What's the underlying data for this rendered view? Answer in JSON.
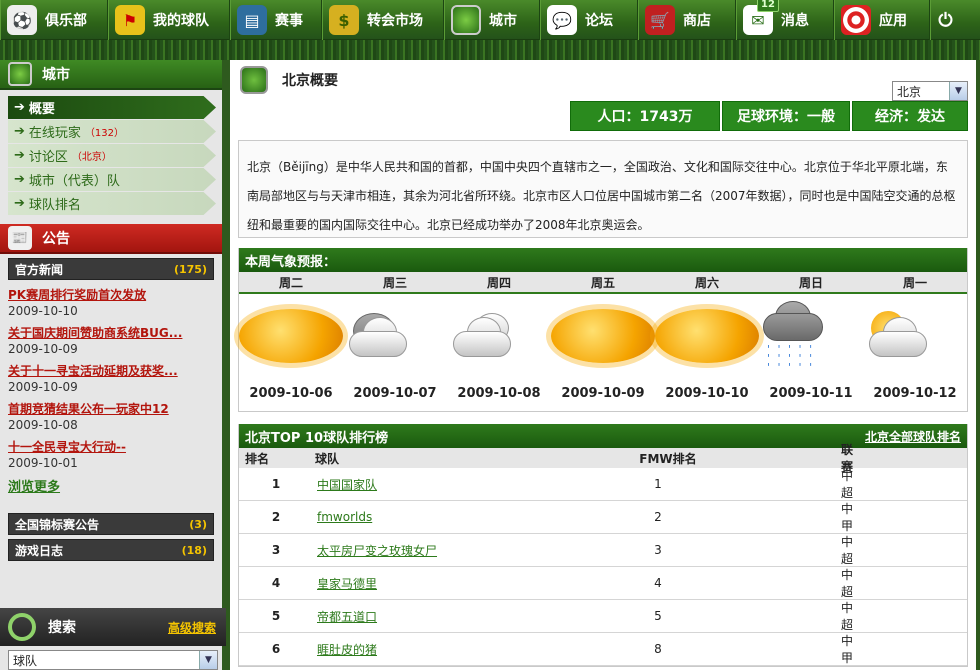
{
  "nav": [
    {
      "label": "俱乐部",
      "icon": "soccer-ball-icon",
      "color": "#3d7d22"
    },
    {
      "label": "我的球队",
      "icon": "flag-icon",
      "color": "#3d7d22"
    },
    {
      "label": "赛事",
      "icon": "ticket-icon",
      "color": "#3d7d22"
    },
    {
      "label": "转会市场",
      "icon": "money-bag-icon",
      "color": "#3d7d22"
    },
    {
      "label": "城市",
      "icon": "stadium-icon",
      "color": "#3d7d22"
    },
    {
      "label": "论坛",
      "icon": "chat-icon",
      "color": "#3d7d22"
    },
    {
      "label": "商店",
      "icon": "cart-icon",
      "color": "#3d7d22"
    },
    {
      "label": "消息",
      "icon": "envelope-icon",
      "color": "#3d7d22",
      "badge": "12"
    },
    {
      "label": "应用",
      "icon": "target-icon",
      "color": "#3d7d22"
    }
  ],
  "sidebar": {
    "city_title": "城市",
    "city_menu": [
      {
        "label": "概要",
        "count": "",
        "active": true
      },
      {
        "label": "在线玩家",
        "count": "（132）"
      },
      {
        "label": "讨论区",
        "count": "（北京）"
      },
      {
        "label": "城市（代表）队",
        "count": ""
      },
      {
        "label": "球队排名",
        "count": ""
      }
    ],
    "announce_title": "公告",
    "news_category": {
      "label": "官方新闻",
      "count": "(175)"
    },
    "news": [
      {
        "title": "PK赛周排行奖励首次发放",
        "date": "2009-10-10"
      },
      {
        "title": "关于国庆期间赞助商系统BUG...",
        "date": "2009-10-09"
      },
      {
        "title": "关于十一寻宝活动延期及获奖...",
        "date": "2009-10-09"
      },
      {
        "title": "首期竞猜结果公布一玩家中12",
        "date": "2009-10-08"
      },
      {
        "title": "十一全民寻宝大行动--",
        "date": "2009-10-01"
      }
    ],
    "more_label": "浏览更多",
    "categories": [
      {
        "label": "全国锦标赛公告",
        "count": "(3)"
      },
      {
        "label": "游戏日志",
        "count": "(18)"
      }
    ],
    "search_title": "搜索",
    "advanced_search": "高级搜索",
    "search_type": "球队"
  },
  "main": {
    "title": "北京概要",
    "city_select": "北京",
    "stats": [
      {
        "label": "人口：1743万"
      },
      {
        "label": "足球环境：一般"
      },
      {
        "label": "经济：发达"
      }
    ],
    "intro": "北京（Běijīng）是中华人民共和国的首都，中国中央四个直辖市之一，全国政治、文化和国际交往中心。北京位于华北平原北端，东南局部地区与与天津市相连，其余为河北省所环绕。北京市区人口位居中国城市第二名（2007年数据），同时也是中国陆空交通的总枢纽和最重要的国内国际交往中心。北京已经成功举办了2008年北京奥运会。",
    "weather_title": "本周气象预报：",
    "weather": [
      {
        "day": "周二",
        "date": "2009-10-06",
        "icon": "sunny-icon"
      },
      {
        "day": "周三",
        "date": "2009-10-07",
        "icon": "cloudy-night-icon"
      },
      {
        "day": "周四",
        "date": "2009-10-08",
        "icon": "cloudy-icon"
      },
      {
        "day": "周五",
        "date": "2009-10-09",
        "icon": "sunny-icon"
      },
      {
        "day": "周六",
        "date": "2009-10-10",
        "icon": "sunny-icon"
      },
      {
        "day": "周日",
        "date": "2009-10-11",
        "icon": "rain-icon"
      },
      {
        "day": "周一",
        "date": "2009-10-12",
        "icon": "partly-cloudy-icon"
      }
    ],
    "rank_title": "北京TOP 10球队排行榜",
    "rank_all_link": "北京全部球队排名",
    "rank_headers": {
      "rank": "排名",
      "team": "球队",
      "fmw": "FMW排名",
      "league": "联赛"
    },
    "rank_rows": [
      {
        "rank": "1",
        "team": "中国国家队",
        "fmw": "1",
        "league": "中超"
      },
      {
        "rank": "2",
        "team": "fmworlds",
        "fmw": "2",
        "league": "中甲"
      },
      {
        "rank": "3",
        "team": "太平房尸变之玫瑰女尸",
        "fmw": "3",
        "league": "中超"
      },
      {
        "rank": "4",
        "team": "皇家马德里",
        "fmw": "4",
        "league": "中超"
      },
      {
        "rank": "5",
        "team": "帝都五道口",
        "fmw": "5",
        "league": "中超"
      },
      {
        "rank": "6",
        "team": "睚肚皮的猪",
        "fmw": "8",
        "league": "中甲"
      }
    ]
  }
}
